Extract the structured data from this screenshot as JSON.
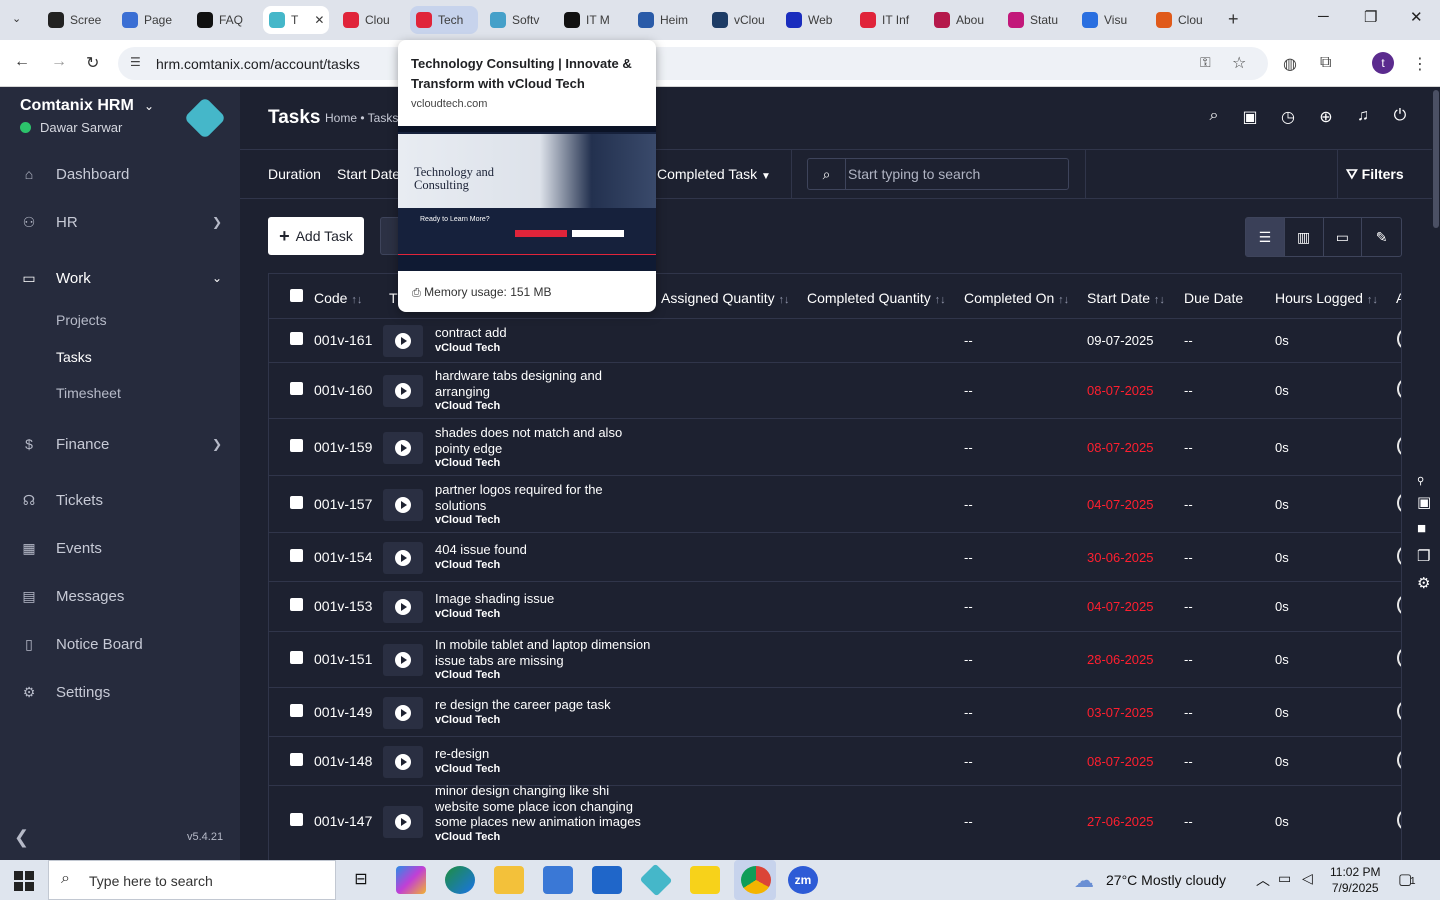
{
  "browser": {
    "tabs": [
      {
        "label": "Scree",
        "color": "#222222"
      },
      {
        "label": "Page",
        "color": "#3b6fd4"
      },
      {
        "label": "FAQ",
        "color": "#111111"
      },
      {
        "label": "T",
        "color": "#45b7c9"
      },
      {
        "label": "Clou",
        "color": "#e0243a"
      },
      {
        "label": "Tech",
        "color": "#e0243a"
      },
      {
        "label": "Softv",
        "color": "#45a0c9"
      },
      {
        "label": "IT M",
        "color": "#111111"
      },
      {
        "label": "Heim",
        "color": "#2a5ba8"
      },
      {
        "label": "vClou",
        "color": "#1d3c66"
      },
      {
        "label": "Web",
        "color": "#1a2dbe"
      },
      {
        "label": "IT Inf",
        "color": "#e0243a"
      },
      {
        "label": "Abou",
        "color": "#b5194b"
      },
      {
        "label": "Statu",
        "color": "#c2187a"
      },
      {
        "label": "Visu",
        "color": "#2a6fe0"
      },
      {
        "label": "Clou",
        "color": "#e05a1a"
      }
    ],
    "new_tab": "+",
    "url": "hrm.comtanix.com/account/tasks",
    "profile_initial": "t"
  },
  "tooltip": {
    "title": "Technology Consulting | Innovate & Transform with vCloud Tech",
    "domain": "vcloudtech.com",
    "preview_heading": "Technology and Consulting",
    "preview_cta": "Ready to Learn More?",
    "memory": "Memory usage: 151 MB"
  },
  "sidebar": {
    "brand": "Comtanix HRM",
    "user": "Dawar Sarwar",
    "items": [
      {
        "label": "Dashboard",
        "icon": "home-icon"
      },
      {
        "label": "HR",
        "icon": "users-icon"
      },
      {
        "label": "Work",
        "icon": "briefcase-icon"
      },
      {
        "label": "Finance",
        "icon": "dollar-icon"
      },
      {
        "label": "Tickets",
        "icon": "headset-icon"
      },
      {
        "label": "Events",
        "icon": "calendar-icon"
      },
      {
        "label": "Messages",
        "icon": "message-icon"
      },
      {
        "label": "Notice Board",
        "icon": "clipboard-icon"
      },
      {
        "label": "Settings",
        "icon": "gear-icon"
      }
    ],
    "work_sub": [
      "Projects",
      "Tasks",
      "Timesheet"
    ],
    "version": "v5.4.21"
  },
  "header": {
    "title": "Tasks",
    "breadcrumb": "Home • Tasks"
  },
  "filters": {
    "duration": "Duration",
    "start_date": "Start Date",
    "status": "Completed Task",
    "search_placeholder": "Start typing to search",
    "filters_btn": "Filters"
  },
  "toolbar": {
    "add_task": "Add Task"
  },
  "table": {
    "headers": [
      "Code",
      "Assigned Quantity",
      "Completed Quantity",
      "Completed On",
      "Start Date",
      "Due Date",
      "Hours Logged"
    ],
    "rows": [
      {
        "code": "001v-161",
        "task": "contract add",
        "project": "vCloud Tech",
        "completed_on": "--",
        "start": "09-07-2025",
        "overdue": false,
        "due": "--",
        "hours": "0s"
      },
      {
        "code": "001v-160",
        "task": "hardware tabs designing and arranging",
        "project": "vCloud Tech",
        "completed_on": "--",
        "start": "08-07-2025",
        "overdue": true,
        "due": "--",
        "hours": "0s"
      },
      {
        "code": "001v-159",
        "task": "shades does not match and also pointy edge",
        "project": "vCloud Tech",
        "completed_on": "--",
        "start": "08-07-2025",
        "overdue": true,
        "due": "--",
        "hours": "0s"
      },
      {
        "code": "001v-157",
        "task": "partner logos required for the solutions",
        "project": "vCloud Tech",
        "completed_on": "--",
        "start": "04-07-2025",
        "overdue": true,
        "due": "--",
        "hours": "0s"
      },
      {
        "code": "001v-154",
        "task": "404 issue found",
        "project": "vCloud Tech",
        "completed_on": "--",
        "start": "30-06-2025",
        "overdue": true,
        "due": "--",
        "hours": "0s"
      },
      {
        "code": "001v-153",
        "task": "Image shading issue",
        "project": "vCloud Tech",
        "completed_on": "--",
        "start": "04-07-2025",
        "overdue": true,
        "due": "--",
        "hours": "0s"
      },
      {
        "code": "001v-151",
        "task": "In mobile tablet and laptop dimension issue tabs are missing",
        "project": "vCloud Tech",
        "completed_on": "--",
        "start": "28-06-2025",
        "overdue": true,
        "due": "--",
        "hours": "0s"
      },
      {
        "code": "001v-149",
        "task": "re design the career page task",
        "project": "vCloud Tech",
        "completed_on": "--",
        "start": "03-07-2025",
        "overdue": true,
        "due": "--",
        "hours": "0s"
      },
      {
        "code": "001v-148",
        "task": "re-design",
        "project": "vCloud Tech",
        "completed_on": "--",
        "start": "08-07-2025",
        "overdue": true,
        "due": "--",
        "hours": "0s"
      },
      {
        "code": "001v-147",
        "task": "minor design changing like shi website some place icon changing some places new animation images",
        "project": "vCloud Tech",
        "completed_on": "--",
        "start": "27-06-2025",
        "overdue": true,
        "due": "--",
        "hours": "0s"
      }
    ]
  },
  "taskbar": {
    "search": "Type here to search",
    "weather": "27°C  Mostly cloudy",
    "time": "11:02 PM",
    "date": "7/9/2025",
    "notifications": "1"
  }
}
